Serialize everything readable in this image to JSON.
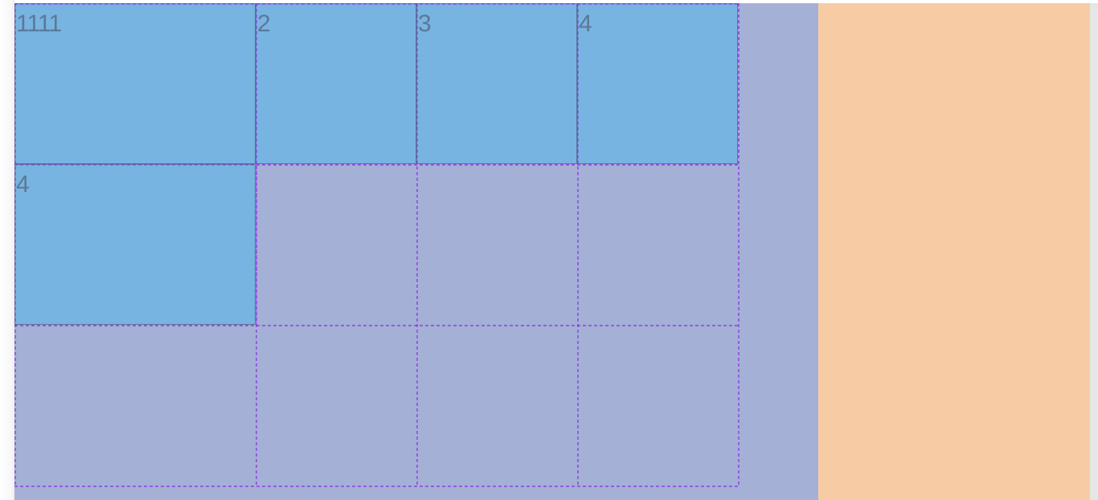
{
  "grid": {
    "items": [
      {
        "label": "1111"
      },
      {
        "label": "2"
      },
      {
        "label": "3"
      },
      {
        "label": "4"
      },
      {
        "label": "4"
      }
    ]
  },
  "colors": {
    "container_bg": "#a4b0d6",
    "item_bg": "#77b4e1",
    "item_text": "#5a7998",
    "grid_line": "#8a2be2",
    "aside_bg": "#f7cca4"
  }
}
